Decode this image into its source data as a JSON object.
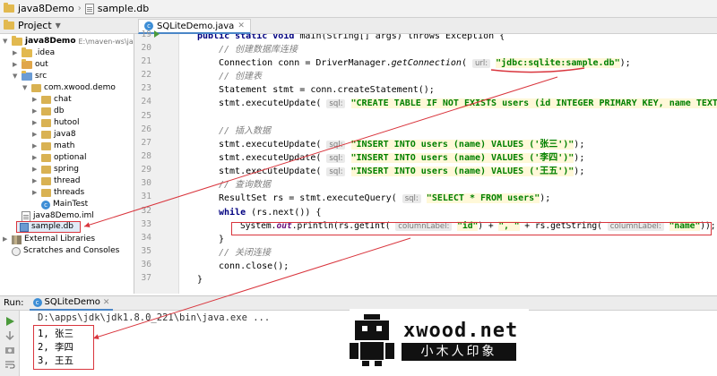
{
  "breadcrumb": {
    "project": "java8Demo",
    "file": "sample.db"
  },
  "project_panel": {
    "title": "Project",
    "tree": [
      {
        "label": "java8Demo",
        "detail": "E:\\maven-ws\\java8D",
        "icon": "folder-icon",
        "expanded": true
      },
      {
        "label": ".idea",
        "icon": "folder-icon",
        "expanded": false
      },
      {
        "label": "out",
        "icon": "folder-icon",
        "expanded": false
      },
      {
        "label": "src",
        "icon": "folder-icon",
        "expanded": true
      },
      {
        "label": "com.xwood.demo",
        "icon": "package-icon",
        "expanded": true
      },
      {
        "label": "chat",
        "icon": "package-icon",
        "expanded": false
      },
      {
        "label": "db",
        "icon": "package-icon",
        "expanded": false
      },
      {
        "label": "hutool",
        "icon": "package-icon",
        "expanded": false
      },
      {
        "label": "java8",
        "icon": "package-icon",
        "expanded": false
      },
      {
        "label": "math",
        "icon": "package-icon",
        "expanded": false
      },
      {
        "label": "optional",
        "icon": "package-icon",
        "expanded": false
      },
      {
        "label": "spring",
        "icon": "package-icon",
        "expanded": false
      },
      {
        "label": "thread",
        "icon": "package-icon",
        "expanded": false
      },
      {
        "label": "threads",
        "icon": "package-icon",
        "expanded": false
      },
      {
        "label": "MainTest",
        "icon": "java-class-icon",
        "expanded": null
      },
      {
        "label": "java8Demo.iml",
        "icon": "iml-file-icon",
        "expanded": null
      },
      {
        "label": "sample.db",
        "icon": "database-file-icon",
        "expanded": null,
        "highlighted": true
      },
      {
        "label": "External Libraries",
        "icon": "library-icon",
        "expanded": false
      },
      {
        "label": "Scratches and Consoles",
        "icon": "scratch-icon",
        "expanded": null
      }
    ]
  },
  "editor": {
    "tab": "SQLiteDemo.java",
    "line_numbers": [
      "19",
      "20",
      "21",
      "22",
      "23",
      "24",
      "25",
      "26",
      "27",
      "28",
      "29",
      "30",
      "31",
      "32",
      "33",
      "34",
      "35",
      "36",
      "37"
    ],
    "lines": {
      "l19_a": "public static void ",
      "l19_b": "main",
      "l19_c": "(String[] args) throws Exception {",
      "l20": "// 创建数据库连接",
      "l21_a": "Connection conn = DriverManager.",
      "l21_b": "getConnection",
      "l21_c": "( ",
      "l21_hint": "url:",
      "l21_str": "\"jdbc:sqlite:sample.db\"",
      "l21_d": ");",
      "l22": "// 创建表",
      "l23": "Statement stmt = conn.createStatement();",
      "l24_a": "stmt.executeUpdate( ",
      "l24_hint": "sql:",
      "l24_str": "\"CREATE TABLE IF NOT EXISTS users (id INTEGER PRIMARY KEY, name TEXT)\"",
      "l24_d": ");",
      "l26": "// 插入数据",
      "l27_a": "stmt.executeUpdate( ",
      "l27_hint": "sql:",
      "l27_str": "\"INSERT INTO users (name) VALUES ('张三')\"",
      "l27_d": ");",
      "l28_a": "stmt.executeUpdate( ",
      "l28_hint": "sql:",
      "l28_str": "\"INSERT INTO users (name) VALUES ('李四')\"",
      "l28_d": ");",
      "l29_a": "stmt.executeUpdate( ",
      "l29_hint": "sql:",
      "l29_str": "\"INSERT INTO users (name) VALUES ('王五')\"",
      "l29_d": ");",
      "l30": "// 查询数据",
      "l31_a": "ResultSet rs = stmt.executeQuery( ",
      "l31_hint": "sql:",
      "l31_str": "\"SELECT * FROM users\"",
      "l31_d": ");",
      "l32_kw": "while",
      "l32_b": " (rs.next()) {",
      "l33_a": "System.",
      "l33_out": "out",
      "l33_b": ".println(rs.getInt( ",
      "l33_hint1": "columnLabel:",
      "l33_str1": "\"id\"",
      "l33_c": ") + ",
      "l33_str2": "\", \"",
      "l33_d": " + rs.getString( ",
      "l33_hint2": "columnLabel:",
      "l33_str3": "\"name\"",
      "l33_e": "));",
      "l34": "}",
      "l35": "// 关闭连接",
      "l36": "conn.close();",
      "l37": "}"
    }
  },
  "run_panel": {
    "label": "Run:",
    "tab": "SQLiteDemo",
    "command": "D:\\apps\\jdk\\jdk1.8.0_221\\bin\\java.exe ...",
    "output": [
      "1, 张三",
      "2, 李四",
      "3, 王五"
    ]
  },
  "watermark": {
    "text": "xwood.net",
    "chinese": "小木人印象"
  },
  "colors": {
    "annotation": "#d9353d",
    "keyword": "#000080",
    "string": "#008000",
    "comment": "#808080"
  }
}
